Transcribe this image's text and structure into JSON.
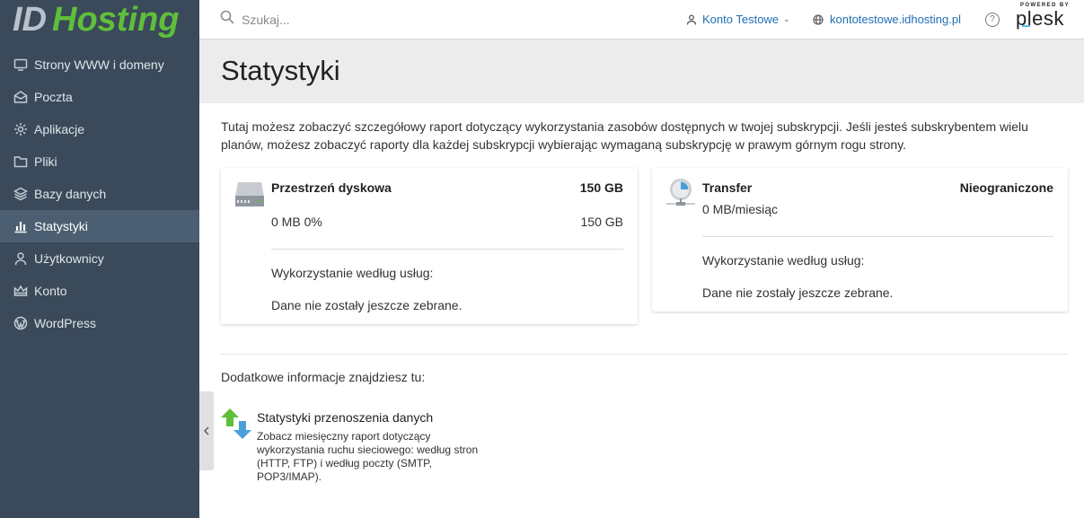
{
  "brand": {
    "logo_text_id": "ID",
    "logo_text_hosting": "Hosting",
    "logo_colors": {
      "id": "#b9c2cc",
      "hosting": "#5fbf3a"
    }
  },
  "sidebar": {
    "items": [
      {
        "label": "Strony WWW i domeny",
        "icon": "monitor-icon",
        "active": false
      },
      {
        "label": "Poczta",
        "icon": "mail-icon",
        "active": false
      },
      {
        "label": "Aplikacje",
        "icon": "gear-icon",
        "active": false
      },
      {
        "label": "Pliki",
        "icon": "folder-icon",
        "active": false
      },
      {
        "label": "Bazy danych",
        "icon": "layers-icon",
        "active": false
      },
      {
        "label": "Statystyki",
        "icon": "bar-chart-icon",
        "active": true
      },
      {
        "label": "Użytkownicy",
        "icon": "user-icon",
        "active": false
      },
      {
        "label": "Konto",
        "icon": "crown-icon",
        "active": false
      },
      {
        "label": "WordPress",
        "icon": "wordpress-icon",
        "active": false
      }
    ]
  },
  "topbar": {
    "search_placeholder": "Szukaj...",
    "account_label": "Konto Testowe",
    "domain_label": "kontotestowe.idhosting.pl",
    "help_label": "?",
    "plesk_powered": "POWERED BY",
    "plesk_name": "plesk"
  },
  "page": {
    "title": "Statystyki",
    "intro": "Tutaj możesz zobaczyć szczegółowy raport dotyczący wykorzystania zasobów dostępnych w twojej subskrypcji. Jeśli jesteś subskrybentem wielu planów, możesz zobaczyć raporty dla każdej subskrypcji wybierając wymaganą subskrypcję w prawym górnym rogu strony."
  },
  "disk": {
    "title": "Przestrzeń dyskowa",
    "total": "150 GB",
    "used": "0 MB 0%",
    "used_right": "150 GB",
    "by_service_label": "Wykorzystanie według usług:",
    "no_data": "Dane nie zostały jeszcze zebrane."
  },
  "transfer": {
    "title": "Transfer",
    "total": "Nieograniczone",
    "used": "0 MB/miesiąc",
    "by_service_label": "Wykorzystanie według usług:",
    "no_data": "Dane nie zostały jeszcze zebrane."
  },
  "more_info": {
    "label": "Dodatkowe informacje znajdziesz tu:",
    "link_title": "Statystyki przenoszenia danych",
    "link_desc": "Zobacz miesięczny raport dotyczący wykorzystania ruchu sieciowego: według stron (HTTP, FTP) i według poczty (SMTP, POP3/IMAP)."
  }
}
